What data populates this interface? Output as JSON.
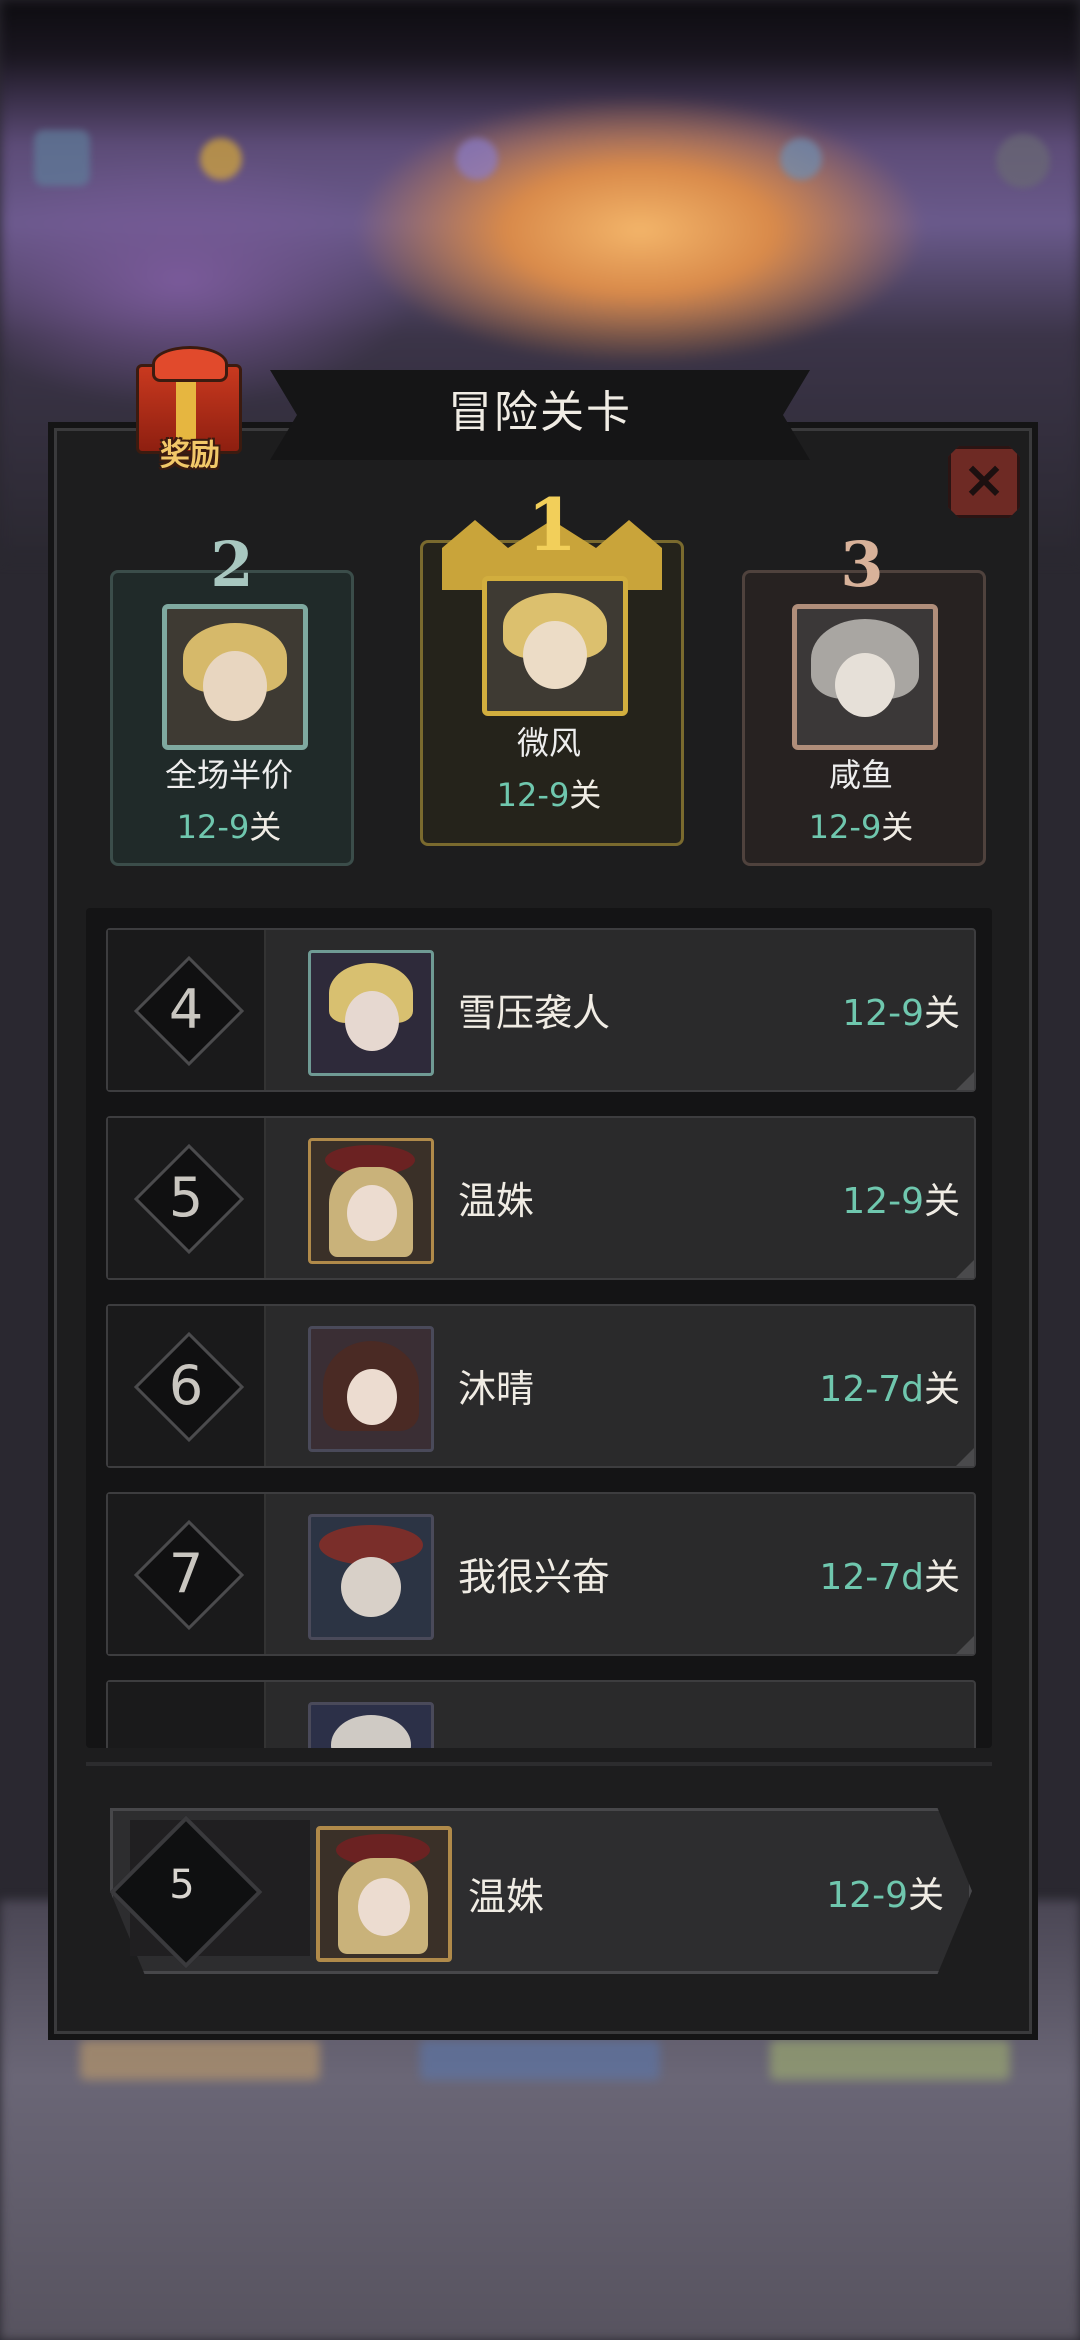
{
  "dialog": {
    "title": "冒险关卡",
    "reward_label": "奖励",
    "close_symbol": "×"
  },
  "podium": [
    {
      "rank": "2",
      "name": "全场半价",
      "stage_num": "12-9",
      "stage_suffix": "关",
      "accent": "#7fa9a0"
    },
    {
      "rank": "1",
      "name": "微风",
      "stage_num": "12-9",
      "stage_suffix": "关",
      "accent": "#c9a43a"
    },
    {
      "rank": "3",
      "name": "咸鱼",
      "stage_num": "12-9",
      "stage_suffix": "关",
      "accent": "#b08e7a"
    }
  ],
  "ranking": [
    {
      "rank": "4",
      "name": "雪压袭人",
      "stage_num": "12-9",
      "stage_suffix": "关"
    },
    {
      "rank": "5",
      "name": "温姝",
      "stage_num": "12-9",
      "stage_suffix": "关"
    },
    {
      "rank": "6",
      "name": "沐晴",
      "stage_num": "12-7d",
      "stage_suffix": "关"
    },
    {
      "rank": "7",
      "name": "我很兴奋",
      "stage_num": "12-7d",
      "stage_suffix": "关"
    }
  ],
  "current_player": {
    "rank": "5",
    "name": "温姝",
    "stage_num": "12-9",
    "stage_suffix": "关"
  },
  "colors": {
    "teal": "#6fc7ae",
    "gold": "#c9a43a",
    "panel": "#1d1d1e"
  }
}
